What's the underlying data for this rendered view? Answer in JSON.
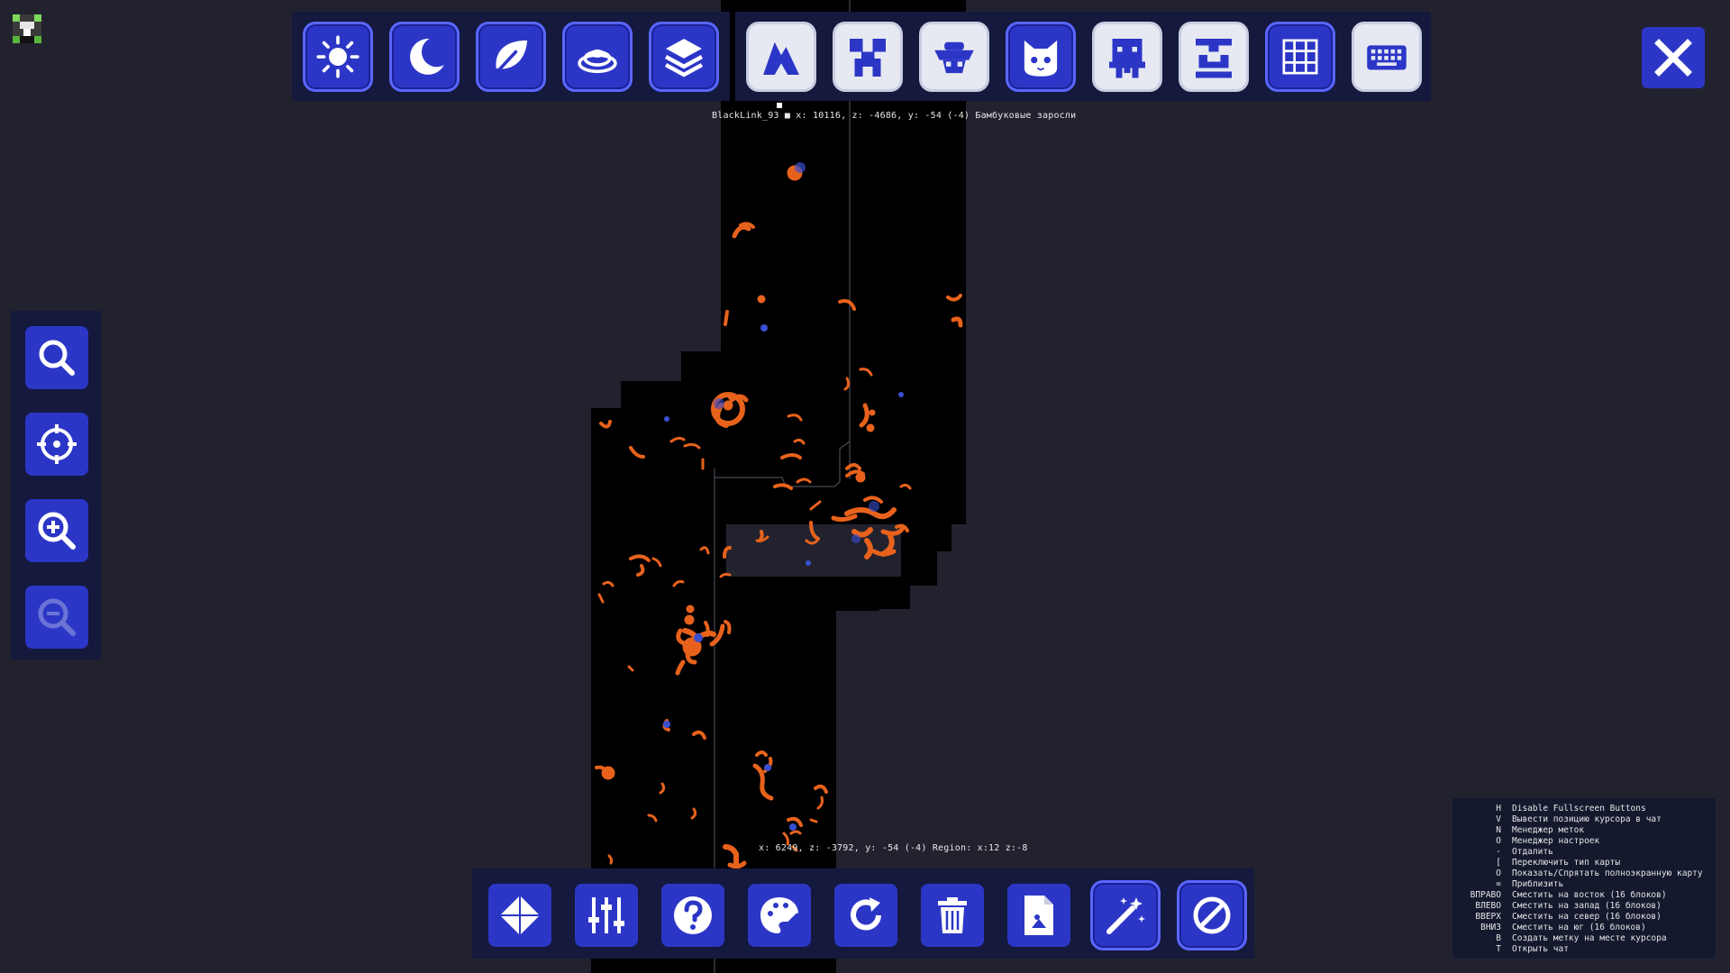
{
  "app": {
    "player_icon": "player-head-icon"
  },
  "colors": {
    "background": "#22222f",
    "panel": "#14193d",
    "button_blue": "#2c36c6",
    "button_light": "#e6e9f2",
    "map_explored": "#000000",
    "lava": "#e8621c"
  },
  "top_toolbar": {
    "map_modes": [
      {
        "icon": "sun-icon",
        "name": "day"
      },
      {
        "icon": "moon-icon",
        "name": "night"
      },
      {
        "icon": "leaf-icon",
        "name": "biome"
      },
      {
        "icon": "topography-icon",
        "name": "topography"
      },
      {
        "icon": "layers-icon",
        "name": "layers"
      }
    ],
    "overlays": [
      {
        "icon": "caves-icon",
        "name": "caves"
      },
      {
        "icon": "creeper-icon",
        "name": "hostile-mobs"
      },
      {
        "icon": "sheep-icon",
        "name": "passive-mobs"
      },
      {
        "icon": "cat-icon",
        "name": "pets"
      },
      {
        "icon": "villager-icon",
        "name": "villagers"
      },
      {
        "icon": "player-icon",
        "name": "players"
      },
      {
        "icon": "grid-icon",
        "name": "grid"
      },
      {
        "icon": "keyboard-icon",
        "name": "keybinds"
      }
    ]
  },
  "player_info": {
    "text": "BlackLink_93 ■ x: 10116, z: -4686, y: -54 (-4) Бамбуковые заросли"
  },
  "cursor_info": {
    "text": "x: 6249, z: -3792, y: -54 (-4)  Region: x:12 z:-8"
  },
  "sidebar": [
    {
      "icon": "search-icon",
      "name": "search"
    },
    {
      "icon": "crosshair-icon",
      "name": "center-on-player"
    },
    {
      "icon": "zoom-in-icon",
      "name": "zoom-in"
    },
    {
      "icon": "zoom-out-icon",
      "name": "zoom-out"
    }
  ],
  "bottom_toolbar": [
    {
      "icon": "diamond-icon",
      "name": "waypoints"
    },
    {
      "icon": "sliders-icon",
      "name": "settings"
    },
    {
      "icon": "help-icon",
      "name": "help"
    },
    {
      "icon": "palette-icon",
      "name": "theme"
    },
    {
      "icon": "refresh-icon",
      "name": "refresh"
    },
    {
      "icon": "trash-icon",
      "name": "delete"
    },
    {
      "icon": "export-icon",
      "name": "export"
    },
    {
      "icon": "magic-wand-icon",
      "name": "auto"
    },
    {
      "icon": "disable-icon",
      "name": "disable"
    }
  ],
  "key_legend": [
    {
      "key": "H",
      "desc": "Disable Fullscreen Buttons"
    },
    {
      "key": "V",
      "desc": "Вывести позицию курсора в чат"
    },
    {
      "key": "N",
      "desc": "Менеджер меток"
    },
    {
      "key": "O",
      "desc": "Менеджер настроек"
    },
    {
      "key": "-",
      "desc": "Отдалить"
    },
    {
      "key": "[",
      "desc": "Переключить тип карты"
    },
    {
      "key": "O",
      "desc": "Показать/Спрятать полноэкранную карту"
    },
    {
      "key": "=",
      "desc": "Приблизить"
    },
    {
      "key": "ВПРАВО",
      "desc": "Сместить на восток (16 блоков)"
    },
    {
      "key": "ВЛЕВО",
      "desc": "Сместить на запад (16 блоков)"
    },
    {
      "key": "ВВЕРХ",
      "desc": "Сместить на север (16 блоков)"
    },
    {
      "key": "ВНИЗ",
      "desc": "Сместить на юг (16 блоков)"
    },
    {
      "key": "B",
      "desc": "Создать метку на месте курсора"
    },
    {
      "key": "T",
      "desc": "Открыть чат"
    }
  ],
  "close": {
    "icon": "close-icon"
  }
}
